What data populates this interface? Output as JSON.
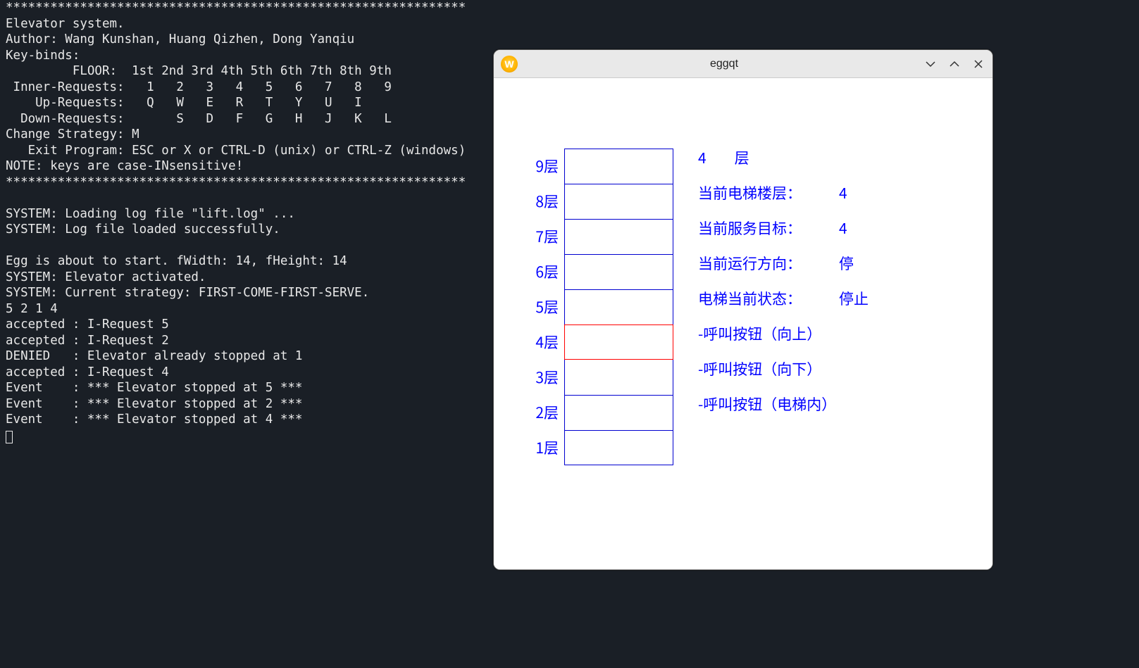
{
  "terminal": {
    "separator": "**************************************************************",
    "title": "Elevator system.",
    "author_line": "Author: Wang Kunshan, Huang Qizhen, Dong Yanqiu",
    "keybinds_label": "Key-binds:",
    "floor_header": "         FLOOR:  1st 2nd 3rd 4th 5th 6th 7th 8th 9th",
    "inner_line": " Inner-Requests:   1   2   3   4   5   6   7   8   9",
    "up_line": "    Up-Requests:   Q   W   E   R   T   Y   U   I",
    "down_line": "  Down-Requests:       S   D   F   G   H   J   K   L",
    "strategy_line": "Change Strategy: M",
    "exit_line": "   Exit Program: ESC or X or CTRL-D (unix) or CTRL-Z (windows)",
    "note_line": "NOTE: keys are case-INsensitive!",
    "log": [
      "",
      "SYSTEM: Loading log file \"lift.log\" ...",
      "SYSTEM: Log file loaded successfully.",
      "",
      "Egg is about to start. fWidth: 14, fHeight: 14",
      "SYSTEM: Elevator activated.",
      "SYSTEM: Current strategy: FIRST-COME-FIRST-SERVE.",
      "5 2 1 4",
      "accepted : I-Request 5",
      "accepted : I-Request 2",
      "DENIED   : Elevator already stopped at 1",
      "accepted : I-Request 4",
      "Event    : *** Elevator stopped at 5 ***",
      "Event    : *** Elevator stopped at 2 ***",
      "Event    : *** Elevator stopped at 4 ***"
    ]
  },
  "gui": {
    "window_title": "eggqt",
    "app_icon_letter": "W",
    "floors": [
      {
        "label": "9层",
        "current": false
      },
      {
        "label": "8层",
        "current": false
      },
      {
        "label": "7层",
        "current": false
      },
      {
        "label": "6层",
        "current": false
      },
      {
        "label": "5层",
        "current": false
      },
      {
        "label": "4层",
        "current": true
      },
      {
        "label": "3层",
        "current": false
      },
      {
        "label": "2层",
        "current": false
      },
      {
        "label": "1层",
        "current": false
      }
    ],
    "header_number": "4",
    "header_unit": "层",
    "status": {
      "current_floor": {
        "label": "当前电梯楼层：",
        "value": "4"
      },
      "target": {
        "label": "当前服务目标：",
        "value": "4"
      },
      "direction": {
        "label": "当前运行方向：",
        "value": "停"
      },
      "state": {
        "label": "电梯当前状态：",
        "value": "停止"
      }
    },
    "buttons": {
      "up": "-呼叫按钮（向上）",
      "down": "-呼叫按钮（向下）",
      "inner": "-呼叫按钮（电梯内）"
    }
  }
}
